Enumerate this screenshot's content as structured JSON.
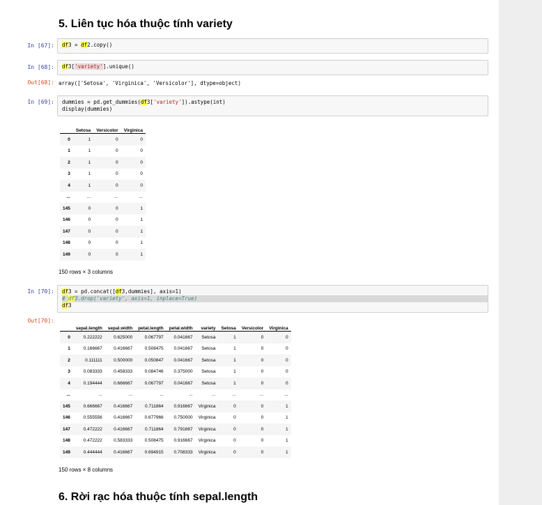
{
  "heading5": "5. Liên tục hóa thuộc tính variety",
  "heading6": "6. Rời rạc hóa thuộc tính sepal.length",
  "cells": {
    "c67": {
      "prompt": "In [67]:",
      "hl1": "df",
      "t1": "3 = ",
      "hl2": "df",
      "t2": "2.copy()"
    },
    "c68": {
      "prompt": "In [68]:",
      "hl1": "df",
      "t1": "3[",
      "str": "'variety'",
      "t2": "].unique()",
      "out_prompt": "Out[68]:",
      "out": "array(['Setosa', 'Virginica', 'Versicolor'], dtype=object)"
    },
    "c69": {
      "prompt": "In [69]:",
      "t1": "dummies = pd.get_dummies(",
      "hl1": "df",
      "t2": "3[",
      "str": "'variety'",
      "t3": "]).astype(int)",
      "line2": "display(dummies)"
    },
    "c70": {
      "prompt": "In [70]:",
      "hl1": "df",
      "t1": "3 = pd.concat([",
      "hl2": "df",
      "t2": "3,dummies], axis=1)",
      "c_hash": "# ",
      "c_hl": "df",
      "c_rest": "3.drop('variety', axis=1, inplace=True)",
      "hl3": "df",
      "t3": "3",
      "out_prompt": "Out[70]:"
    }
  },
  "table1": {
    "columns": [
      "",
      "Setosa",
      "Versicolor",
      "Virginica"
    ],
    "rows": [
      [
        "0",
        "1",
        "0",
        "0"
      ],
      [
        "1",
        "1",
        "0",
        "0"
      ],
      [
        "2",
        "1",
        "0",
        "0"
      ],
      [
        "3",
        "1",
        "0",
        "0"
      ],
      [
        "4",
        "1",
        "0",
        "0"
      ],
      [
        "...",
        "...",
        "...",
        "..."
      ],
      [
        "145",
        "0",
        "0",
        "1"
      ],
      [
        "146",
        "0",
        "0",
        "1"
      ],
      [
        "147",
        "0",
        "0",
        "1"
      ],
      [
        "148",
        "0",
        "0",
        "1"
      ],
      [
        "149",
        "0",
        "0",
        "1"
      ]
    ],
    "caption": "150 rows × 3 columns"
  },
  "table2": {
    "columns": [
      "",
      "sepal.length",
      "sepal.width",
      "petal.length",
      "petal.width",
      "variety",
      "Setosa",
      "Versicolor",
      "Virginica"
    ],
    "rows": [
      [
        "0",
        "0.222222",
        "0.625000",
        "0.067797",
        "0.041667",
        "Setosa",
        "1",
        "0",
        "0"
      ],
      [
        "1",
        "0.166667",
        "0.416667",
        "0.508475",
        "0.041667",
        "Setosa",
        "1",
        "0",
        "0"
      ],
      [
        "2",
        "0.111111",
        "0.500000",
        "0.050847",
        "0.041667",
        "Setosa",
        "1",
        "0",
        "0"
      ],
      [
        "3",
        "0.083333",
        "0.458333",
        "0.084746",
        "0.375000",
        "Setosa",
        "1",
        "0",
        "0"
      ],
      [
        "4",
        "0.194444",
        "0.666667",
        "0.067797",
        "0.041667",
        "Setosa",
        "1",
        "0",
        "0"
      ],
      [
        "...",
        "...",
        "...",
        "...",
        "...",
        "...",
        "...",
        "...",
        "..."
      ],
      [
        "145",
        "0.666667",
        "0.416667",
        "0.711864",
        "0.916667",
        "Virginica",
        "0",
        "0",
        "1"
      ],
      [
        "146",
        "0.555556",
        "0.416667",
        "0.677966",
        "0.750000",
        "Virginica",
        "0",
        "0",
        "1"
      ],
      [
        "147",
        "0.472222",
        "0.416667",
        "0.711864",
        "0.791667",
        "Virginica",
        "0",
        "0",
        "1"
      ],
      [
        "148",
        "0.472222",
        "0.583333",
        "0.508475",
        "0.916667",
        "Virginica",
        "0",
        "0",
        "1"
      ],
      [
        "149",
        "0.444444",
        "0.416667",
        "0.694915",
        "0.708333",
        "Virginica",
        "0",
        "0",
        "1"
      ]
    ],
    "caption": "150 rows × 8 columns"
  }
}
